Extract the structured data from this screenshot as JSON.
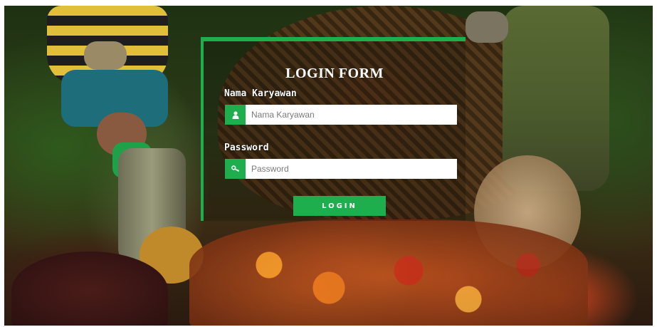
{
  "login_form": {
    "title": "LOGIN FORM",
    "name_label": "Nama Karyawan",
    "name_placeholder": "Nama Karyawan",
    "name_icon": "user-icon",
    "password_label": "Password",
    "password_placeholder": "Password",
    "password_icon": "key-icon",
    "login_button_label": "LOGIN"
  },
  "colors": {
    "accent": "#1fae4e",
    "input_background": "#ffffff",
    "text": "#ffffff"
  }
}
